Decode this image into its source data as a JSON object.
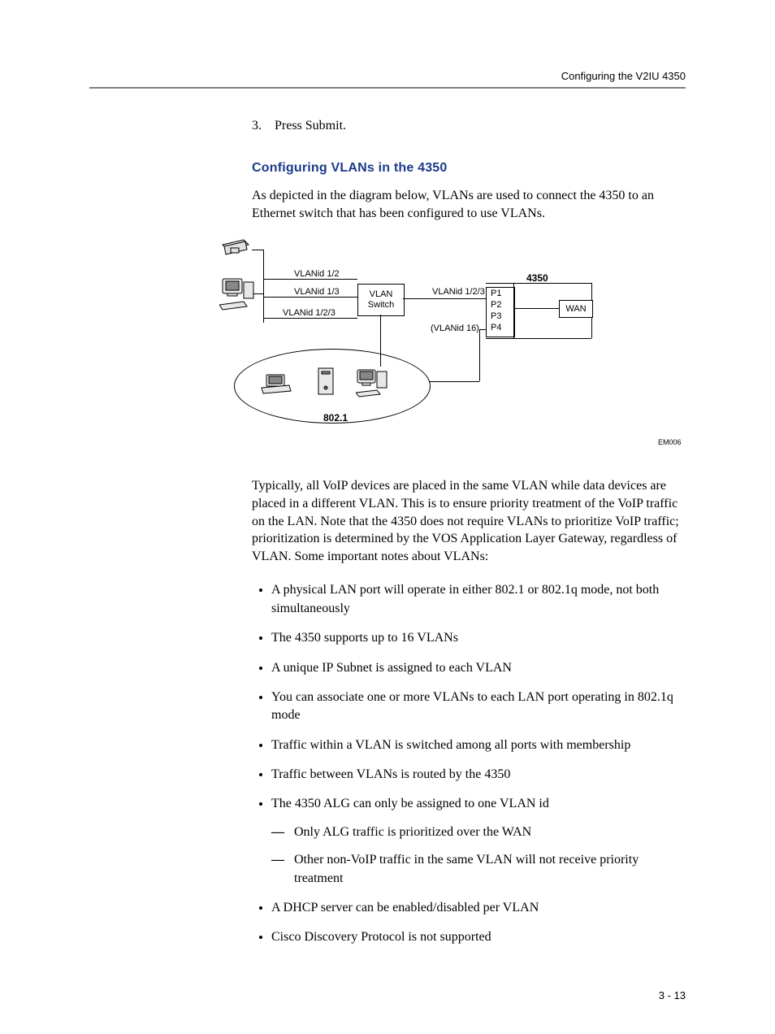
{
  "header": {
    "running_head": "Configuring the V2IU 4350"
  },
  "step": {
    "number": "3.",
    "text": "Press Submit."
  },
  "section": {
    "title": "Configuring VLANs in the 4350",
    "intro": "As depicted in the diagram below, VLANs are used to connect the 4350 to an Ethernet switch that has been configured to use VLANs."
  },
  "diagram": {
    "vlan12": "VLANid 1/2",
    "vlan13": "VLANid 1/3",
    "vlan123_left": "VLANid 1/2/3",
    "vlan_switch_line1": "VLAN",
    "vlan_switch_line2": "Switch",
    "vlan123_mid": "VLANid 1/2/3",
    "vlan16": "(VLANid 16)",
    "title4350": "4350",
    "p1": "P1",
    "p2": "P2",
    "p3": "P3",
    "p4": "P4",
    "wan": "WAN",
    "cloud": "802.1",
    "code": "EM006"
  },
  "para2": "Typically, all VoIP devices are placed in the same VLAN while data devices are placed in a different VLAN. This is to ensure priority treatment of the VoIP traffic on the LAN. Note that the 4350 does not require VLANs to prioritize VoIP traffic; prioritization is determined by the VOS Application Layer Gateway, regardless of VLAN. Some important notes about VLANs:",
  "bullets": [
    "A physical LAN port will operate in either 802.1 or 802.1q mode, not both simultaneously",
    "The 4350 supports up to 16 VLANs",
    "A unique IP Subnet is assigned to each VLAN",
    "You can associate one or more VLANs to each LAN port operating in 802.1q mode",
    "Traffic within a VLAN is switched among all ports with membership",
    "Traffic between VLANs is routed by the 4350",
    "The 4350 ALG can only be assigned to one VLAN id",
    "A DHCP server can be enabled/disabled per VLAN",
    "Cisco Discovery Protocol is not supported"
  ],
  "sub_bullets": [
    "Only ALG traffic is prioritized over the WAN",
    "Other non-VoIP traffic in the same VLAN will not receive priority treatment"
  ],
  "footer": {
    "page": "3 - 13"
  }
}
